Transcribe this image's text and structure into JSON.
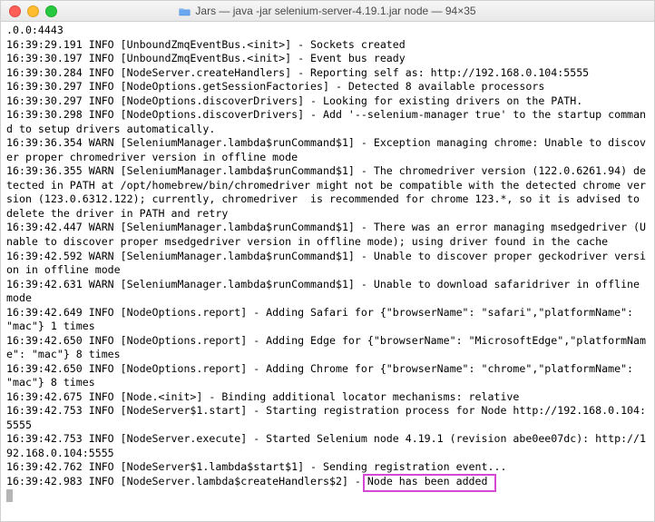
{
  "window": {
    "title": "Jars — java -jar selenium-server-4.19.1.jar node — 94×35"
  },
  "log": {
    "lines": [
      ".0.0:4443",
      "16:39:29.191 INFO [UnboundZmqEventBus.<init>] - Sockets created",
      "16:39:30.197 INFO [UnboundZmqEventBus.<init>] - Event bus ready",
      "16:39:30.284 INFO [NodeServer.createHandlers] - Reporting self as: http://192.168.0.104:5555",
      "16:39:30.297 INFO [NodeOptions.getSessionFactories] - Detected 8 available processors",
      "16:39:30.297 INFO [NodeOptions.discoverDrivers] - Looking for existing drivers on the PATH.",
      "16:39:30.298 INFO [NodeOptions.discoverDrivers] - Add '--selenium-manager true' to the startup command to setup drivers automatically.",
      "16:39:36.354 WARN [SeleniumManager.lambda$runCommand$1] - Exception managing chrome: Unable to discover proper chromedriver version in offline mode",
      "16:39:36.355 WARN [SeleniumManager.lambda$runCommand$1] - The chromedriver version (122.0.6261.94) detected in PATH at /opt/homebrew/bin/chromedriver might not be compatible with the detected chrome version (123.0.6312.122); currently, chromedriver  is recommended for chrome 123.*, so it is advised to delete the driver in PATH and retry",
      "16:39:42.447 WARN [SeleniumManager.lambda$runCommand$1] - There was an error managing msedgedriver (Unable to discover proper msedgedriver version in offline mode); using driver found in the cache",
      "16:39:42.592 WARN [SeleniumManager.lambda$runCommand$1] - Unable to discover proper geckodriver version in offline mode",
      "16:39:42.631 WARN [SeleniumManager.lambda$runCommand$1] - Unable to download safaridriver in offline mode",
      "16:39:42.649 INFO [NodeOptions.report] - Adding Safari for {\"browserName\": \"safari\",\"platformName\": \"mac\"} 1 times",
      "16:39:42.650 INFO [NodeOptions.report] - Adding Edge for {\"browserName\": \"MicrosoftEdge\",\"platformName\": \"mac\"} 8 times",
      "16:39:42.650 INFO [NodeOptions.report] - Adding Chrome for {\"browserName\": \"chrome\",\"platformName\": \"mac\"} 8 times",
      "16:39:42.675 INFO [Node.<init>] - Binding additional locator mechanisms: relative",
      "16:39:42.753 INFO [NodeServer$1.start] - Starting registration process for Node http://192.168.0.104:5555",
      "16:39:42.753 INFO [NodeServer.execute] - Started Selenium node 4.19.1 (revision abe0ee07dc): http://192.168.0.104:5555",
      "16:39:42.762 INFO [NodeServer$1.lambda$start$1] - Sending registration event...",
      "16:39:42.983 INFO [NodeServer.lambda$createHandlers$2] - Node has been added"
    ]
  },
  "highlight": {
    "text": "Node has been added"
  }
}
